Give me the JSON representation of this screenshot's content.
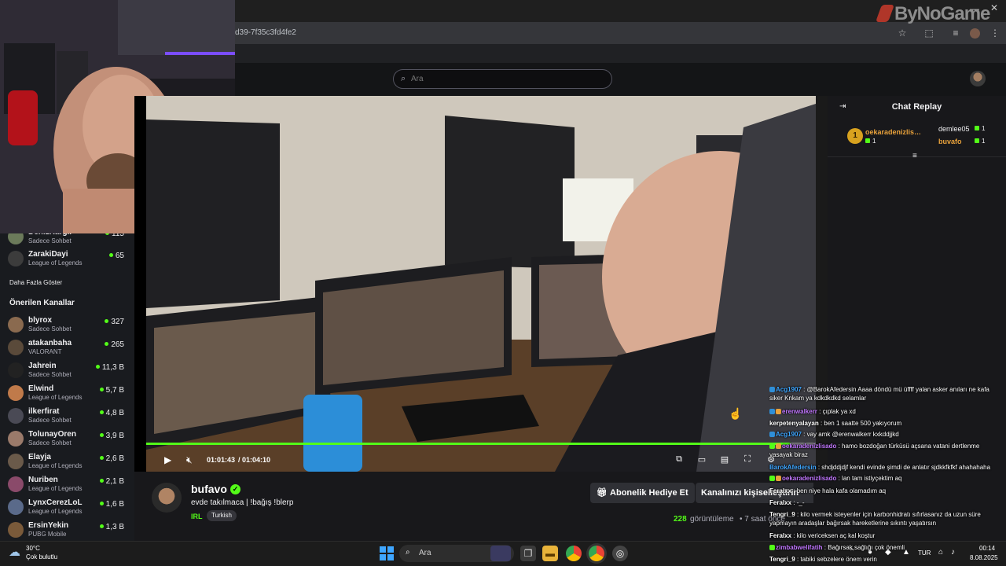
{
  "browser": {
    "url": "d39-7f35c3fd4fe2",
    "watermark": "ByNoGame"
  },
  "header": {
    "search_placeholder": "Ara"
  },
  "sidebar": {
    "followed": [
      {
        "name": "DenizKargil",
        "category": "",
        "viewers": "115",
        "avatar_color": "#6b7a5a"
      },
      {
        "name": "ZarakiDayi",
        "category": "League of Legends",
        "viewers": "65",
        "avatar_color": "#3c3c3c"
      }
    ],
    "followed_top_category": "Sadece Sohbet",
    "show_more": "Daha Fazla Göster",
    "recommended_heading": "Önerilen Kanallar",
    "recommended": [
      {
        "name": "blyrox",
        "category": "Sadece Sohbet",
        "viewers": "327",
        "avatar_color": "#8a6a4f"
      },
      {
        "name": "atakanbaha",
        "category": "VALORANT",
        "viewers": "265",
        "avatar_color": "#5a4a3a"
      },
      {
        "name": "Jahrein",
        "category": "Sadece Sohbet",
        "viewers": "11,3 B",
        "avatar_color": "#222"
      },
      {
        "name": "Elwind",
        "category": "League of Legends",
        "viewers": "5,7 B",
        "avatar_color": "#c07a4a"
      },
      {
        "name": "ilkerfirat",
        "category": "Sadece Sohbet",
        "viewers": "4,8 B",
        "avatar_color": "#4a4a55"
      },
      {
        "name": "TolunayOren",
        "category": "Sadece Sohbet",
        "viewers": "3,9 B",
        "avatar_color": "#9a7a6a"
      },
      {
        "name": "Elayja",
        "category": "League of Legends",
        "viewers": "2,6 B",
        "avatar_color": "#6a5a4a"
      },
      {
        "name": "Nuriben",
        "category": "League of Legends",
        "viewers": "2,1 B",
        "avatar_color": "#8a4a6a"
      },
      {
        "name": "LynxCerezLoL",
        "category": "League of Legends",
        "viewers": "1,6 B",
        "avatar_color": "#5a6a8a"
      },
      {
        "name": "ErsinYekin",
        "category": "PUBG Mobile",
        "viewers": "1,3 B",
        "avatar_color": "#7a5a3a"
      }
    ]
  },
  "player": {
    "time_current": "01:01:43",
    "time_separator": "/",
    "time_total": "01:04:10",
    "progress": 0.962
  },
  "stream": {
    "streamer": "bufavo",
    "title": "evde takılmaca  | !bağış !blerp",
    "category": "IRL",
    "language": "Turkish",
    "gift_sub_label": "Abonelik Hediye Et",
    "customize_label": "Kanalınızı kişiselleştirin",
    "viewers": "228",
    "viewers_label": "görüntüleme",
    "age": "• 7 saat önce"
  },
  "chat": {
    "title": "Chat Replay",
    "top_gifters": [
      {
        "rank": "1",
        "name": "oekaradenizlisado",
        "count": "1"
      },
      {
        "name": "demlee05",
        "count": "1"
      },
      {
        "name": "buvafo",
        "count": "1"
      }
    ],
    "messages": [
      {
        "user": "Acg1907",
        "color": "#3ea6ff",
        "text": ": @BarokAfedersin Aaaa döndü mü üffff yalan asker anıları ne kafa siker Knkam ya kdkdkdkd selamlar",
        "badges": [
          "#2f8fd8"
        ]
      },
      {
        "user": "erenwalkerr",
        "color": "#c177ff",
        "text": ": çıplak ya xd",
        "badges": [
          "#2f8fd8",
          "#e9a23b"
        ]
      },
      {
        "user": "kerpetenyalayan",
        "color": "#ffffff",
        "text": ": ben 1 saatte 500 yakıyorum",
        "badges": []
      },
      {
        "user": "Acg1907",
        "color": "#3ea6ff",
        "text": ": vay amk @erenwalkerr kxkddjjkd",
        "badges": [
          "#2f8fd8"
        ]
      },
      {
        "user": "oekaradenizlisado",
        "color": "#c177ff",
        "text": ": hamo bozdoğan türküsü açsana vatani dertlenme yasayak biraz",
        "badges": [
          "#53fc18",
          "#e9a23b"
        ]
      },
      {
        "user": "BarokAfedersin",
        "color": "#3ea6ff",
        "text": ": shdjddjdjf kendi evinde şimdi de anlatır sjdkkfkfkf ahahahaha",
        "badges": []
      },
      {
        "user": "oekaradenizlisado",
        "color": "#c177ff",
        "text": ": lan tam istiyçektim aq",
        "badges": [
          "#53fc18",
          "#e9a23b"
        ]
      },
      {
        "user": "Feralxx",
        "color": "#ffffff",
        "text": ": ben niye hala kafa olamadım aq",
        "badges": []
      },
      {
        "user": "Feralxx",
        "color": "#ffffff",
        "text": ": -_-",
        "badges": []
      },
      {
        "user": "Tengri_9",
        "color": "#ffffff",
        "text": ": kilo vermek isteyenler için karbonhidratı sıfırlasanız da uzun süre yapmayın aradaşlar bağırsak hareketlerine sıkıntı yaşatırsın",
        "badges": []
      },
      {
        "user": "Feralxx",
        "color": "#ffffff",
        "text": ": kilo vericeksen aç kal koştur",
        "badges": []
      },
      {
        "user": "zimbabwelifatih",
        "color": "#c177ff",
        "text": ": Bağırsak sağlığı çok önemli",
        "badges": [
          "#53fc18"
        ]
      },
      {
        "user": "Tengri_9",
        "color": "#ffffff",
        "text": ": tabiki sebzelere önem verin",
        "badges": []
      }
    ]
  },
  "taskbar": {
    "temperature": "30°C",
    "weather": "Çok bulutlu",
    "search_label": "Ara",
    "language": "TUR",
    "time": "00:14",
    "date": "8.08.2025"
  }
}
